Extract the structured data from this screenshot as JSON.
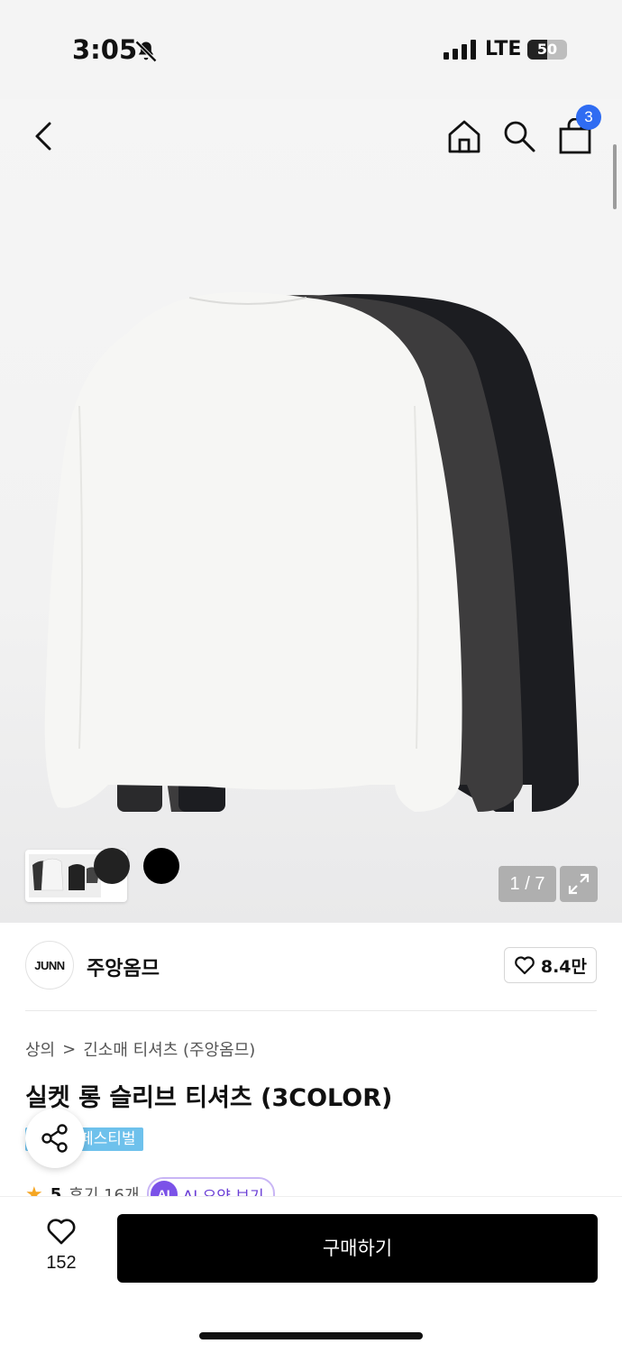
{
  "status_bar": {
    "time": "3:05",
    "network": "LTE",
    "battery": "50",
    "battery_level": 0.5
  },
  "nav": {
    "back_icon": "chevron-left-icon",
    "home_icon": "home-icon",
    "search_icon": "search-icon",
    "cart_icon": "shopping-bag-icon",
    "cart_count": "3"
  },
  "gallery": {
    "page_counter": "1 / 7",
    "expand_icon": "expand-icon",
    "thumb_arrow": "›"
  },
  "brand": {
    "logo_text": "JUNN",
    "name": "주앙옴므",
    "likes": "8.4만"
  },
  "product": {
    "breadcrumb": [
      "상의",
      "긴소매 티셔츠 (주앙옴므)"
    ],
    "breadcrumb_separator": ">",
    "title": "실켓 롱 슬리브 티셔츠 (3COLOR)",
    "badge": "페스티벌",
    "rating": "5",
    "review_count": "후기 16개",
    "ai_label": "AI",
    "ai_summary": "AI 요약 보기"
  },
  "bottom": {
    "like_count": "152",
    "buy_label": "구매하기"
  },
  "colors": {
    "accent_blue": "#2f6cf2",
    "badge_blue": "#6ec1ec",
    "ai_purple": "#7b52e8",
    "buy_black": "#000000"
  }
}
